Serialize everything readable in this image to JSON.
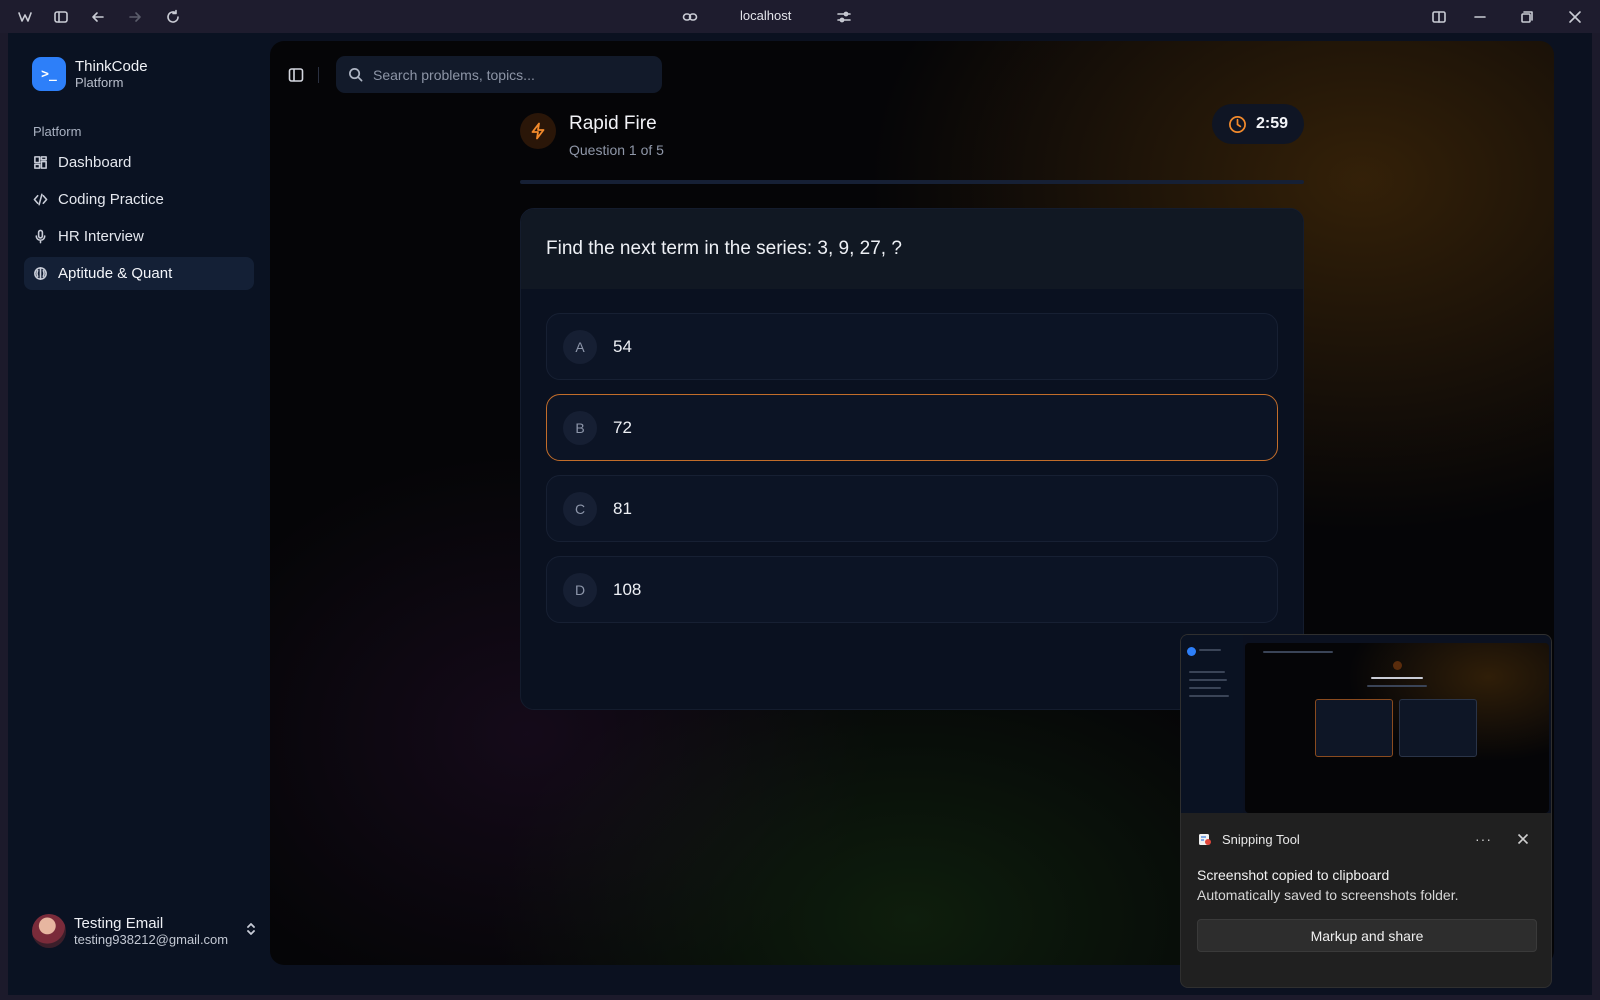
{
  "browser": {
    "url": "localhost",
    "icons": [
      "app-logo-icon",
      "sidebar-panel-icon",
      "back-icon",
      "forward-icon",
      "reload-icon",
      "link-icon",
      "site-settings-icon",
      "split-view-icon",
      "minimize-icon",
      "restore-icon",
      "close-icon"
    ]
  },
  "sidebar": {
    "brand_name": "ThinkCode",
    "brand_sub": "Platform",
    "section_label": "Platform",
    "items": [
      {
        "label": "Dashboard",
        "icon": "dashboard-icon",
        "active": false
      },
      {
        "label": "Coding Practice",
        "icon": "code-icon",
        "active": false
      },
      {
        "label": "HR Interview",
        "icon": "microphone-icon",
        "active": false
      },
      {
        "label": "Aptitude & Quant",
        "icon": "brain-icon",
        "active": true
      }
    ],
    "user": {
      "name": "Testing Email",
      "email": "testing938212@gmail.com"
    }
  },
  "topbar": {
    "search_placeholder": "Search problems, topics..."
  },
  "quiz": {
    "title": "Rapid Fire",
    "subtitle": "Question 1 of 5",
    "timer": "2:59",
    "progress": 0.0,
    "question": "Find the next term in the series: 3, 9, 27, ?",
    "options": [
      {
        "letter": "A",
        "text": "54",
        "selected": false
      },
      {
        "letter": "B",
        "text": "72",
        "selected": true
      },
      {
        "letter": "C",
        "text": "81",
        "selected": false
      },
      {
        "letter": "D",
        "text": "108",
        "selected": false
      }
    ]
  },
  "toast": {
    "app_name": "Snipping Tool",
    "more": "···",
    "title": "Screenshot copied to clipboard",
    "body": "Automatically saved to screenshots folder.",
    "button": "Markup and share"
  },
  "colors": {
    "accent": "#f28a2c",
    "brand": "#2d7ff9",
    "selected_border": "#c26d2a"
  }
}
